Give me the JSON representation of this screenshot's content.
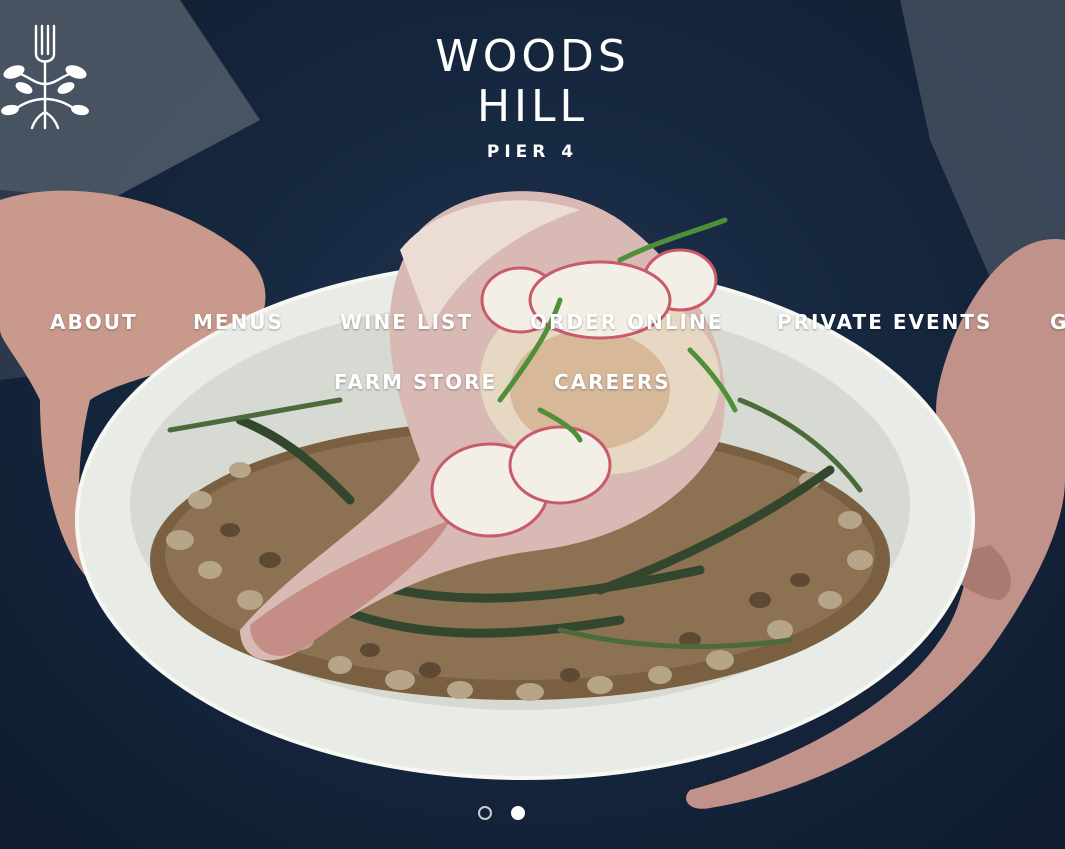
{
  "brand": {
    "name_line1": "WOODS",
    "name_line2": "HILL",
    "location": "PIER 4",
    "icon": "fork-tree-logo-icon"
  },
  "nav": {
    "items": [
      {
        "label": "ABOUT"
      },
      {
        "label": "MENUS"
      },
      {
        "label": "WINE LIST"
      },
      {
        "label": "ORDER ONLINE"
      },
      {
        "label": "PRIVATE EVENTS"
      },
      {
        "label": "G"
      },
      {
        "label": "FARM STORE"
      },
      {
        "label": "CAREERS"
      }
    ]
  },
  "slider": {
    "slide_count": 2,
    "active_index": 1
  },
  "colors": {
    "background_navy": "#16273f",
    "text": "#ffffff",
    "bowl": "#eceee9"
  }
}
